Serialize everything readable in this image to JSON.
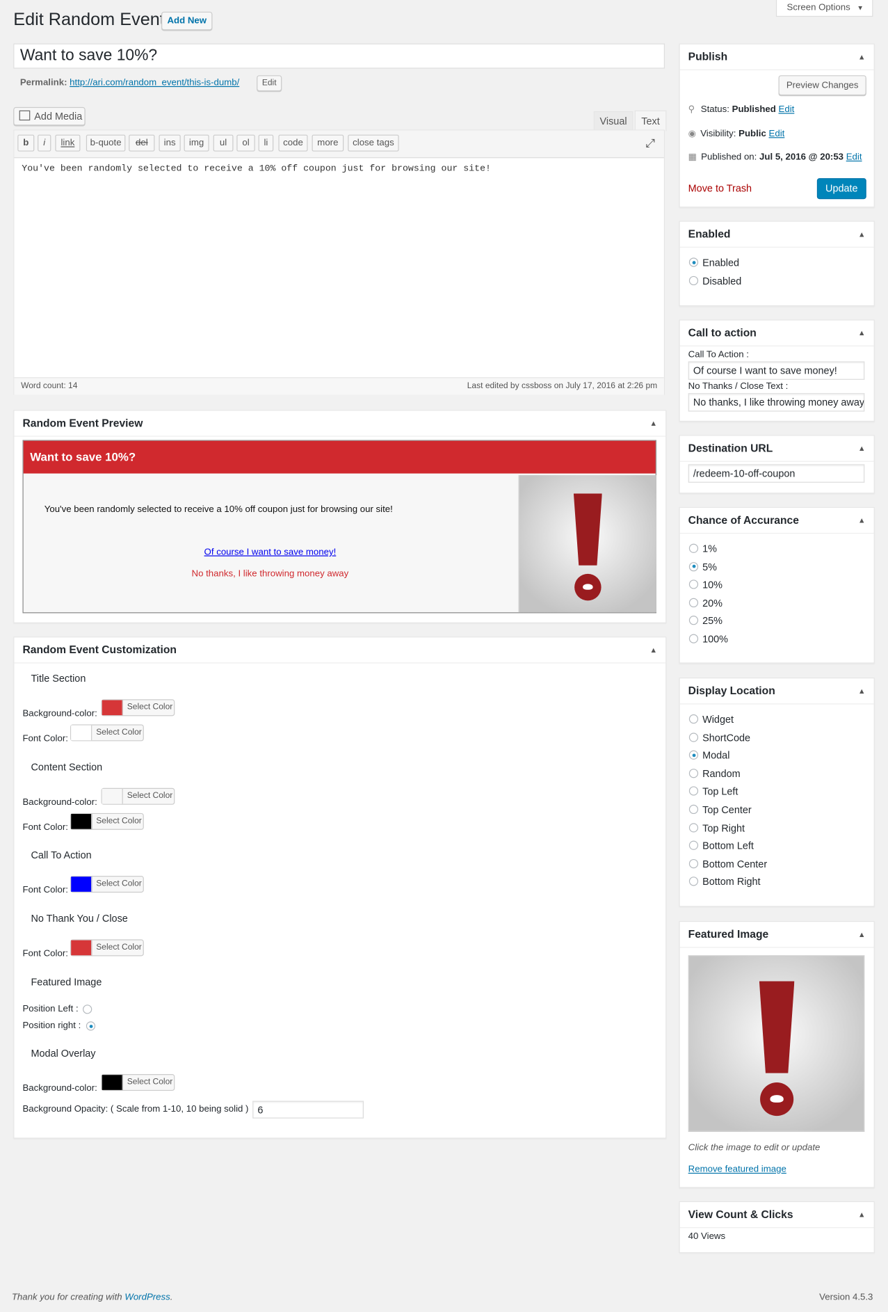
{
  "header": {
    "title": "Edit Random Event",
    "add_new": "Add New",
    "screen_options": "Screen Options"
  },
  "post": {
    "title": "Want to save 10%?",
    "permalink_label": "Permalink:",
    "permalink_url": "http://ari.com/random_event/this-is-dumb/",
    "permalink_edit": "Edit"
  },
  "editor": {
    "add_media": "Add Media",
    "tab_visual": "Visual",
    "tab_text": "Text",
    "quicktags": [
      "b",
      "i",
      "link",
      "b-quote",
      "del",
      "ins",
      "img",
      "ul",
      "ol",
      "li",
      "code",
      "more",
      "close tags"
    ],
    "content": "You've been randomly selected to receive a 10% off coupon just for browsing our site!",
    "word_count": "Word count: 14",
    "last_edited": "Last edited by cssboss on July 17, 2016 at 2:26 pm"
  },
  "preview": {
    "box_title": "Random Event Preview",
    "title": "Want to save 10%?",
    "body": "You've been randomly selected to receive a 10% off coupon just for browsing our site!",
    "cta": "Of course I want to save money!",
    "no_thanks": "No thanks, I like throwing money away",
    "title_bg": "#d0292e",
    "cta_color": "#0000ee",
    "no_thanks_color": "#d0292e"
  },
  "custom": {
    "box_title": "Random Event Customization",
    "title_section": "Title Section",
    "content_section": "Content Section",
    "cta_section": "Call To Action",
    "nothanks_section": "No Thank You / Close",
    "featured_section": "Featured Image",
    "overlay_section": "Modal Overlay",
    "bg_label": "Background-color:",
    "font_label": "Font Color:",
    "select_color": "Select Color",
    "pos_left": "Position Left :",
    "pos_right": "Position right :",
    "opacity_label": "Background Opacity: ( Scale from 1-10, 10 being solid )",
    "opacity_value": "6",
    "colors": {
      "title_bg": "#d63638",
      "title_font": "#ffffff",
      "content_bg": "#f7f7f7",
      "content_font": "#000000",
      "cta_font": "#0000ff",
      "nothanks_font": "#d63638",
      "overlay_bg": "#000000"
    }
  },
  "publish": {
    "title": "Publish",
    "preview_changes": "Preview Changes",
    "status_label": "Status:",
    "status_value": "Published",
    "visibility_label": "Visibility:",
    "visibility_value": "Public",
    "published_label": "Published on:",
    "published_value": "Jul 5, 2016 @ 20:53",
    "edit": "Edit",
    "trash": "Move to Trash",
    "update": "Update"
  },
  "enabled": {
    "title": "Enabled",
    "options": [
      "Enabled",
      "Disabled"
    ],
    "selected": "Enabled"
  },
  "cta_box": {
    "title": "Call to action",
    "cta_label": "Call To Action :",
    "cta_value": "Of course I want to save money!",
    "close_label": "No Thanks / Close Text :",
    "close_value": "No thanks, I like throwing money away"
  },
  "destination": {
    "title": "Destination URL",
    "value": "/redeem-10-off-coupon"
  },
  "chance": {
    "title": "Chance of Accurance",
    "options": [
      "1%",
      "5%",
      "10%",
      "20%",
      "25%",
      "100%"
    ],
    "selected": "5%"
  },
  "display": {
    "title": "Display Location",
    "options": [
      "Widget",
      "ShortCode",
      "Modal",
      "Random",
      "Top Left",
      "Top Center",
      "Top Right",
      "Bottom Left",
      "Bottom Center",
      "Bottom Right"
    ],
    "selected": "Modal"
  },
  "featured": {
    "title": "Featured Image",
    "hint": "Click the image to edit or update",
    "remove": "Remove featured image"
  },
  "views": {
    "title": "View Count & Clicks",
    "value": "40 Views"
  },
  "footer": {
    "thanks": "Thank you for creating with",
    "wp": "WordPress",
    "version": "Version 4.5.3"
  }
}
